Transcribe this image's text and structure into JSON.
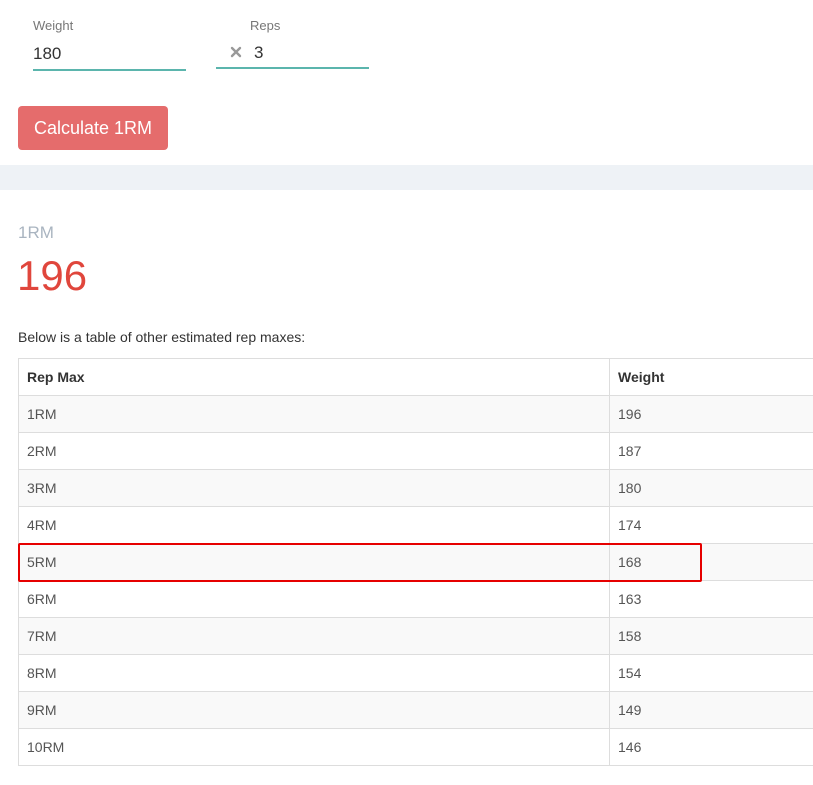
{
  "form": {
    "weight": {
      "label": "Weight",
      "value": "180"
    },
    "reps": {
      "label": "Reps",
      "value": "3",
      "separator_icon": "close-x-icon"
    },
    "calculate_label": "Calculate 1RM"
  },
  "result": {
    "label": "1RM",
    "value": "196"
  },
  "table": {
    "caption": "Below is a table of other estimated rep maxes:",
    "headers": [
      "Rep Max",
      "Weight"
    ],
    "rows": [
      [
        "1RM",
        "196"
      ],
      [
        "2RM",
        "187"
      ],
      [
        "3RM",
        "180"
      ],
      [
        "4RM",
        "174"
      ],
      [
        "5RM",
        "168"
      ],
      [
        "6RM",
        "163"
      ],
      [
        "7RM",
        "158"
      ],
      [
        "8RM",
        "154"
      ],
      [
        "9RM",
        "149"
      ],
      [
        "10RM",
        "146"
      ]
    ],
    "highlighted_row": "5RM"
  },
  "colors": {
    "accent_button": "#e56c6c",
    "result_value": "#e0463c",
    "input_underline": "#5bb5ad",
    "highlight_border": "#e60000"
  }
}
